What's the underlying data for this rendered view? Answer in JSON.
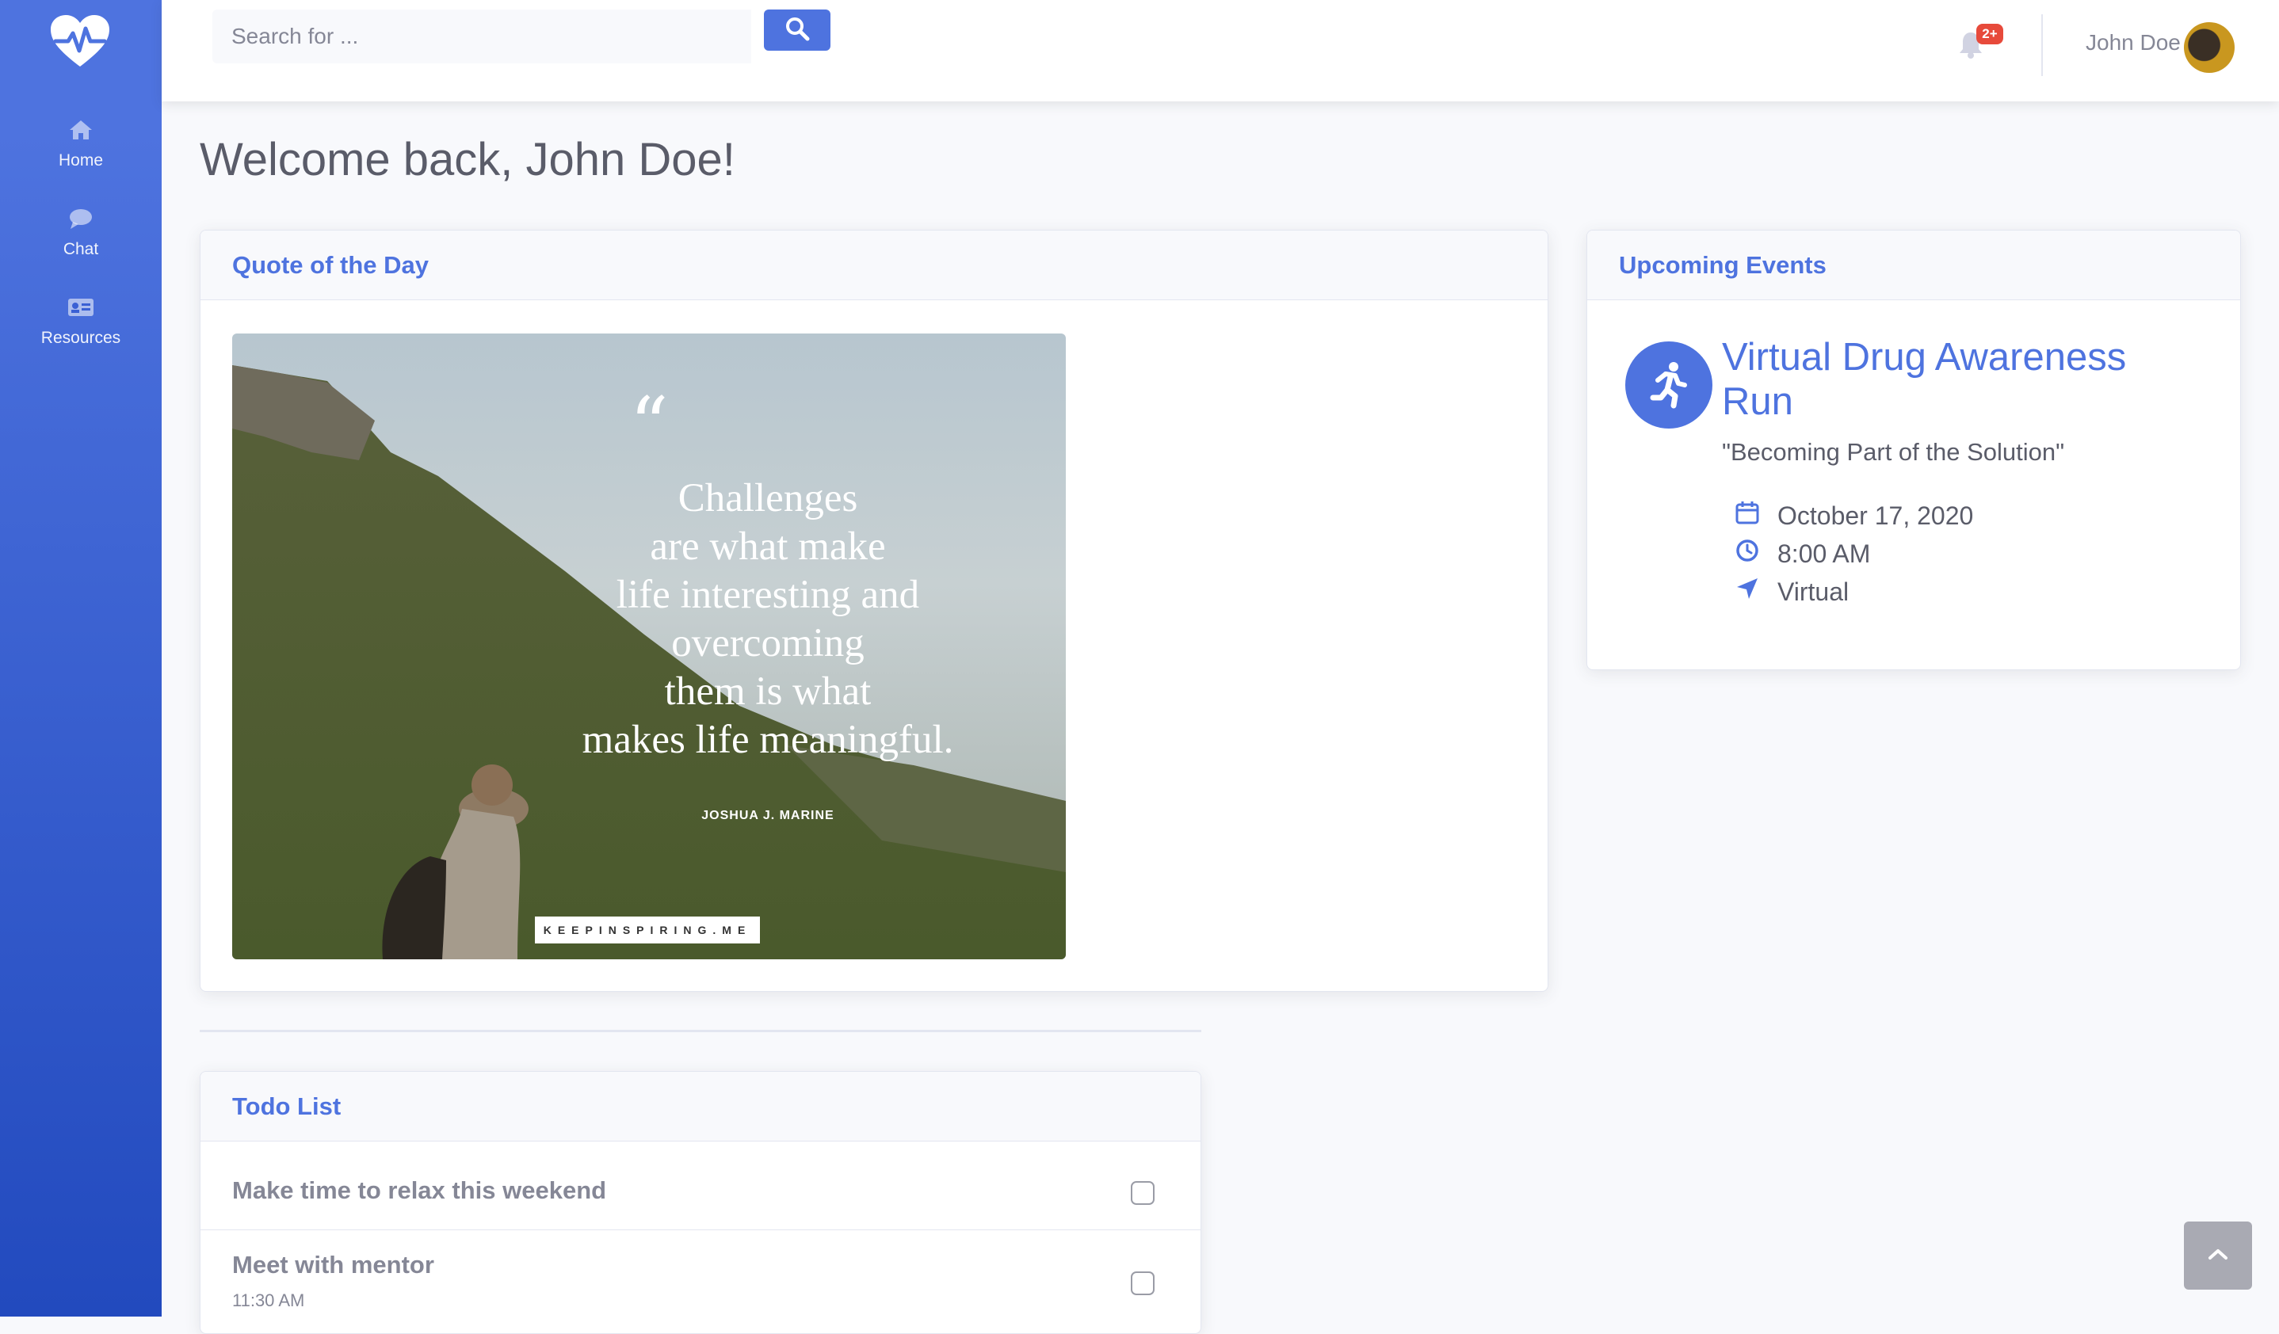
{
  "sidebar": {
    "brand_icon": "heartbeat-icon",
    "items": [
      {
        "label": "Home",
        "icon": "home-icon"
      },
      {
        "label": "Chat",
        "icon": "chat-bubble-icon"
      },
      {
        "label": "Resources",
        "icon": "id-card-icon"
      }
    ],
    "colors": {
      "gradient_top": "#4e73df",
      "gradient_bottom": "#224abe"
    }
  },
  "topbar": {
    "search": {
      "placeholder": "Search for ...",
      "value": "",
      "button_icon": "search-icon"
    },
    "notifications": {
      "icon": "bell-icon",
      "badge": "2+"
    },
    "user": {
      "name": "John Doe"
    }
  },
  "main": {
    "title": "Welcome back, John Doe!",
    "quote_card": {
      "header": "Quote of the Day",
      "quote_mark": "“",
      "quote": "Challenges\nare what make\nlife interesting and\novercoming\nthem is what\nmakes life meaningful.",
      "author": "JOSHUA J. MARINE",
      "source": "KEEPINSPIRING.ME"
    },
    "events_card": {
      "header": "Upcoming Events",
      "event": {
        "icon": "running-icon",
        "title": "Virtual Drug Awareness Run",
        "tagline": "\"Becoming Part of the Solution\"",
        "date": "October 17, 2020",
        "time": "8:00 AM",
        "location": "Virtual"
      }
    },
    "todo_card": {
      "header": "Todo List",
      "items": [
        {
          "text": "Make time to relax this weekend",
          "time": ""
        },
        {
          "text": "Meet with mentor",
          "time": "11:30 AM"
        }
      ]
    }
  },
  "colors": {
    "primary": "#4e73df",
    "danger": "#e74a3b",
    "background": "#f8f9fc"
  }
}
